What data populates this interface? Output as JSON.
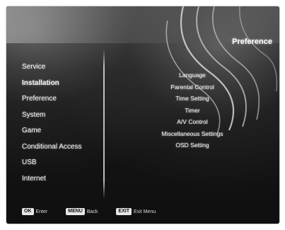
{
  "header": {
    "title": "Preference"
  },
  "left_menu": {
    "items": [
      {
        "label": "Service"
      },
      {
        "label": "Installation"
      },
      {
        "label": "Preference"
      },
      {
        "label": "System"
      },
      {
        "label": "Game"
      },
      {
        "label": "Conditional Access"
      },
      {
        "label": "USB"
      },
      {
        "label": "Internet"
      }
    ]
  },
  "submenu": {
    "items": [
      {
        "label": "Language"
      },
      {
        "label": "Parental Control"
      },
      {
        "label": "Time Setting"
      },
      {
        "label": "Timer"
      },
      {
        "label": "A/V Control"
      },
      {
        "label": "Miscellaneous Settings"
      },
      {
        "label": "OSD Setting"
      }
    ]
  },
  "footer": {
    "hints": [
      {
        "key": "OK",
        "label": "Enter"
      },
      {
        "key": "MENU",
        "label": "Back"
      },
      {
        "key": "EXIT",
        "label": "Exit Menu"
      }
    ]
  }
}
